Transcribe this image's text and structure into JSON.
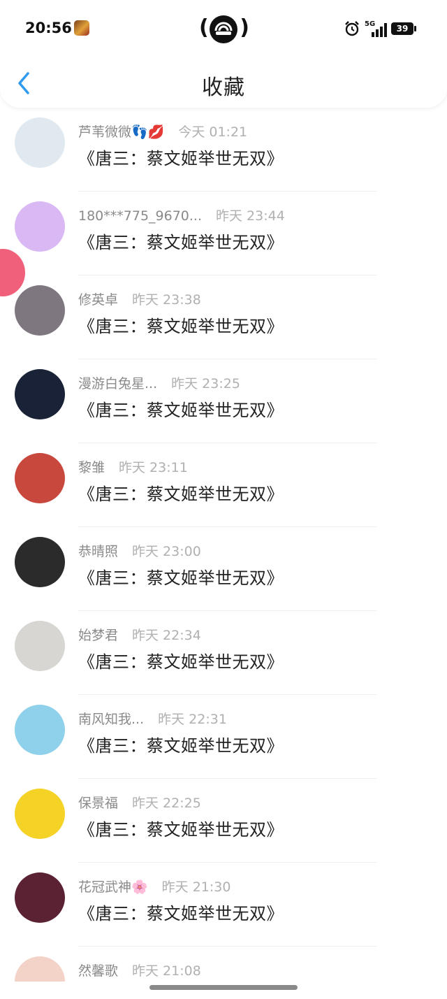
{
  "status_bar": {
    "time": "20:56",
    "network": "5G",
    "battery": "39"
  },
  "header": {
    "title": "收藏",
    "back_icon": "chevron-left-icon",
    "accent_color": "#2f9bf0"
  },
  "items": [
    {
      "name": "芦苇微微👣💋",
      "time": "今天 01:21",
      "content": "《唐三：蔡文姬举世无双》",
      "avatar_bg": "#dfe9ef"
    },
    {
      "name": "180***775_9670...",
      "time": "昨天 23:44",
      "content": "《唐三：蔡文姬举世无双》",
      "avatar_bg": "#d9b8f4"
    },
    {
      "name": "修英卓",
      "time": "昨天 23:38",
      "content": "《唐三：蔡文姬举世无双》",
      "avatar_bg": "#7f7780"
    },
    {
      "name": "漫游白兔星...",
      "time": "昨天 23:25",
      "content": "《唐三：蔡文姬举世无双》",
      "avatar_bg": "#1a2238"
    },
    {
      "name": "黎雏",
      "time": "昨天 23:11",
      "content": "《唐三：蔡文姬举世无双》",
      "avatar_bg": "#c9483e"
    },
    {
      "name": "恭晴照",
      "time": "昨天 23:00",
      "content": "《唐三：蔡文姬举世无双》",
      "avatar_bg": "#2b2b2b"
    },
    {
      "name": "始梦君",
      "time": "昨天 22:34",
      "content": "《唐三：蔡文姬举世无双》",
      "avatar_bg": "#d8d6d2"
    },
    {
      "name": "南风知我...",
      "time": "昨天 22:31",
      "content": "《唐三：蔡文姬举世无双》",
      "avatar_bg": "#8fd1ea"
    },
    {
      "name": "保景福",
      "time": "昨天 22:25",
      "content": "《唐三：蔡文姬举世无双》",
      "avatar_bg": "#f4d226"
    },
    {
      "name": "花冠武神🌸",
      "time": "昨天 21:30",
      "content": "《唐三：蔡文姬举世无双》",
      "avatar_bg": "#5a2233"
    },
    {
      "name": "然馨歌",
      "time": "昨天 21:08",
      "content": "",
      "avatar_bg": "#f3d3c8"
    }
  ]
}
